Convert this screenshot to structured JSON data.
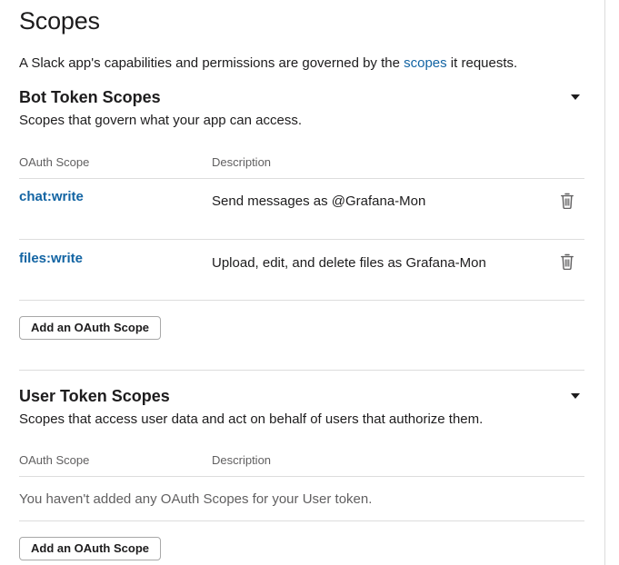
{
  "page": {
    "title": "Scopes",
    "intro_prefix": "A Slack app's capabilities and permissions are governed by the ",
    "intro_link": "scopes",
    "intro_suffix": " it requests."
  },
  "bot_section": {
    "title": "Bot Token Scopes",
    "subtitle": "Scopes that govern what your app can access.",
    "col_scope": "OAuth Scope",
    "col_description": "Description",
    "rows": [
      {
        "scope": "chat:write",
        "description": "Send messages as @Grafana-Mon"
      },
      {
        "scope": "files:write",
        "description": "Upload, edit, and delete files as Grafana-Mon"
      }
    ],
    "add_button": "Add an OAuth Scope"
  },
  "user_section": {
    "title": "User Token Scopes",
    "subtitle": "Scopes that access user data and act on behalf of users that authorize them.",
    "col_scope": "OAuth Scope",
    "col_description": "Description",
    "empty_message": "You haven't added any OAuth Scopes for your User token.",
    "add_button": "Add an OAuth Scope"
  },
  "icons": {
    "collapse": "caret-down-icon",
    "remove": "trash-icon"
  },
  "colors": {
    "link": "#1264a3",
    "text": "#1d1c1d",
    "muted": "#616061",
    "divider": "#dddddd"
  }
}
